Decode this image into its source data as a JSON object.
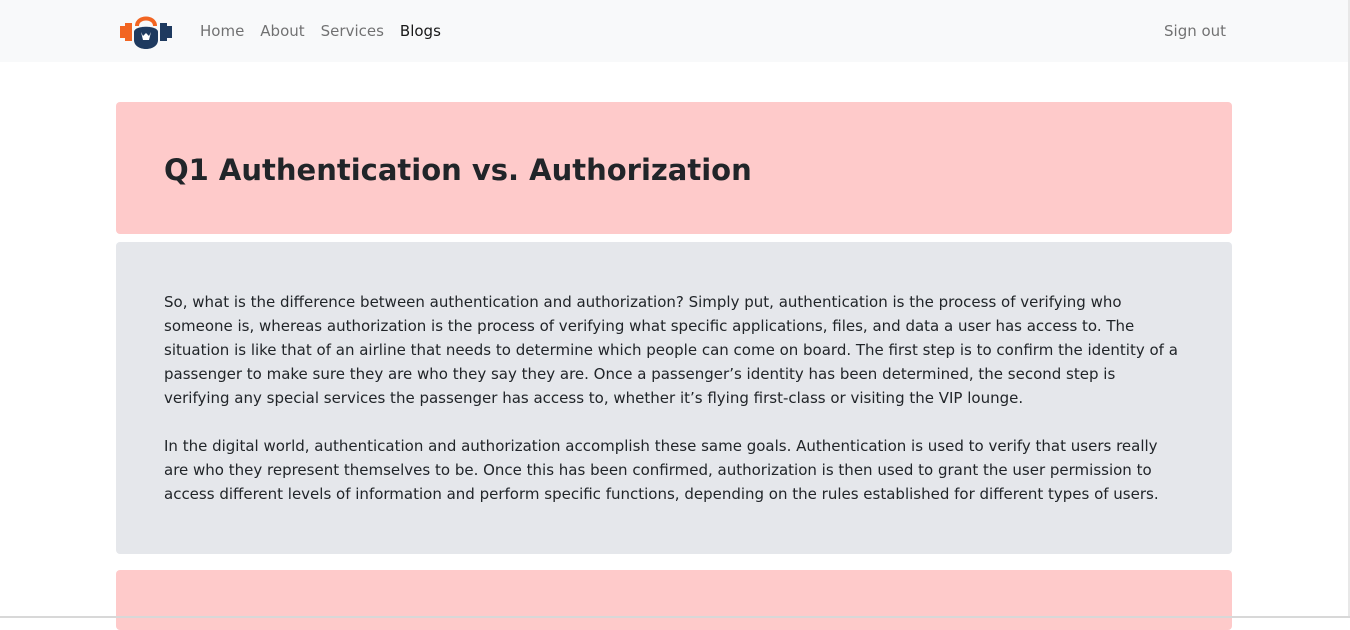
{
  "nav": {
    "logo_icon": "kettlebell-dumbbell-logo",
    "links": [
      {
        "label": "Home"
      },
      {
        "label": "About"
      },
      {
        "label": "Services"
      },
      {
        "label": "Blogs"
      }
    ],
    "signout_label": "Sign out"
  },
  "question": {
    "title": "Q1 Authentication vs. Authorization"
  },
  "answer": {
    "paragraphs": [
      "So, what is the difference between authentication and authorization? Simply put, authentication is the process of verifying who someone is, whereas authorization is the process of verifying what specific applications, files, and data a user has access to. The situation is like that of an airline that needs to determine which people can come on board. The first step is to confirm the identity of a passenger to make sure they are who they say they are. Once a passenger’s identity has been determined, the second step is verifying any special services the passenger has access to, whether it’s flying first-class or visiting the VIP lounge.",
      "In the digital world, authentication and authorization accomplish these same goals. Authentication is used to verify that users really are who they represent themselves to be. Once this has been confirmed, authorization is then used to grant the user permission to access different levels of information and perform specific functions, depending on the rules established for different types of users."
    ]
  },
  "colors": {
    "header_bg": "#fecaca",
    "answer_bg": "#e5e7eb",
    "navbar_bg": "#f8f9fa",
    "logo_orange": "#f26522",
    "logo_navy": "#1e3a5f"
  }
}
